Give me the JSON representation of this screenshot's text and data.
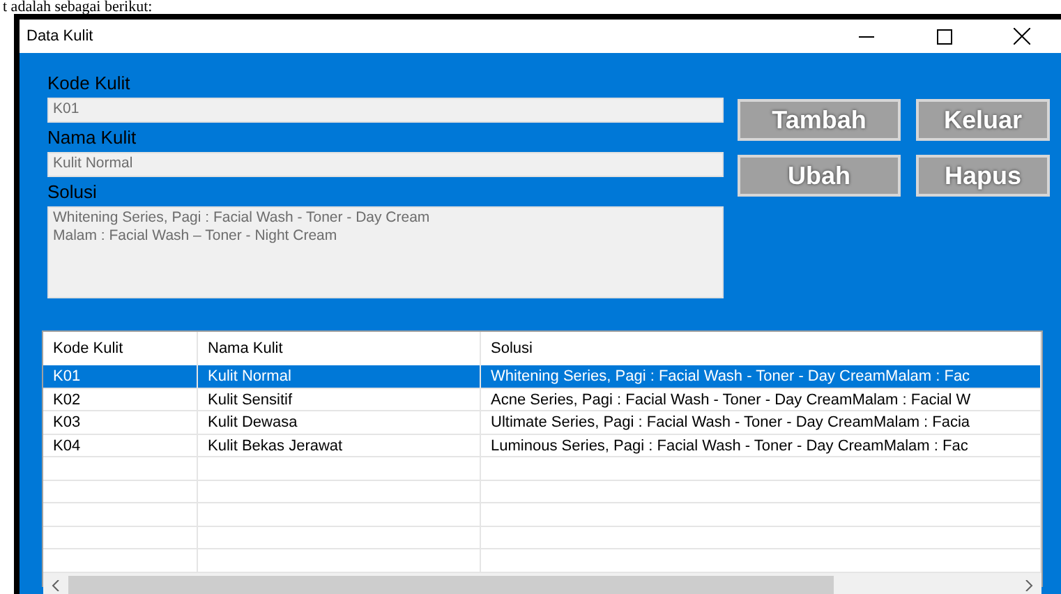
{
  "document_text": "t adalah sebagai berikut:",
  "window": {
    "title": "Data Kulit"
  },
  "fields": [
    {
      "label": "Kode Kulit",
      "value": "K01",
      "kind": "line"
    },
    {
      "label": "Nama Kulit",
      "value": "Kulit Normal",
      "kind": "line"
    },
    {
      "label": "Solusi",
      "value": "Whitening Series, Pagi : Facial Wash - Toner - Day Cream\nMalam : Facial Wash – Toner - Night Cream",
      "kind": "area"
    }
  ],
  "buttons": [
    "Tambah",
    "Keluar",
    "Ubah",
    "Hapus"
  ],
  "table": {
    "columns": [
      "Kode Kulit",
      "Nama Kulit",
      "Solusi"
    ],
    "rows": [
      {
        "cells": [
          "K01",
          "Kulit Normal",
          "Whitening Series, Pagi : Facial Wash - Toner - Day CreamMalam : Fac"
        ],
        "selected": true
      },
      {
        "cells": [
          "K02",
          "Kulit Sensitif",
          "Acne Series, Pagi : Facial Wash - Toner - Day CreamMalam : Facial W"
        ],
        "selected": false
      },
      {
        "cells": [
          "K03",
          "Kulit Dewasa",
          "Ultimate Series, Pagi : Facial Wash - Toner - Day CreamMalam : Facia"
        ],
        "selected": false
      },
      {
        "cells": [
          "K04",
          "Kulit Bekas Jerawat",
          "Luminous Series, Pagi : Facial Wash - Toner - Day CreamMalam : Fac"
        ],
        "selected": false
      }
    ]
  }
}
